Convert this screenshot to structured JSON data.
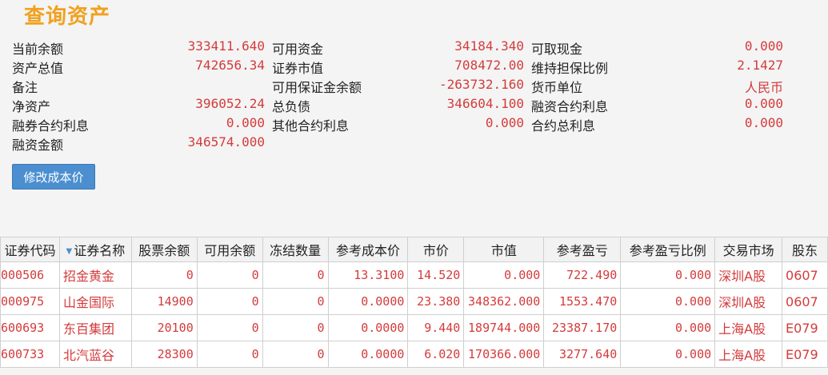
{
  "page": {
    "title": "查询资产"
  },
  "summary": {
    "rows": [
      [
        {
          "label": "当前余额",
          "value": "333411.640"
        },
        {
          "label": "可用资金",
          "value": "34184.340"
        },
        {
          "label": "可取现金",
          "value": "0.000"
        }
      ],
      [
        {
          "label": "资产总值",
          "value": "742656.34"
        },
        {
          "label": "证券市值",
          "value": "708472.00"
        },
        {
          "label": "维持担保比例",
          "value": "2.1427"
        }
      ],
      [
        {
          "label": "备注",
          "value": ""
        },
        {
          "label": "可用保证金余额",
          "value": "-263732.160"
        },
        {
          "label": "货币单位",
          "value": "人民币"
        }
      ],
      [
        {
          "label": "净资产",
          "value": "396052.24"
        },
        {
          "label": "总负债",
          "value": "346604.100"
        },
        {
          "label": "融资合约利息",
          "value": "0.000"
        }
      ],
      [
        {
          "label": "融券合约利息",
          "value": "0.000"
        },
        {
          "label": "其他合约利息",
          "value": "0.000"
        },
        {
          "label": "合约总利息",
          "value": "0.000"
        }
      ],
      [
        {
          "label": "融资金额",
          "value": "346574.000"
        }
      ]
    ]
  },
  "actions": {
    "modify_cost_label": "修改成本价"
  },
  "holdings": {
    "columns": [
      "证券代码",
      "证券名称",
      "股票余额",
      "可用余额",
      "冻结数量",
      "参考成本价",
      "市价",
      "市值",
      "参考盈亏",
      "参考盈亏比例",
      "交易市场",
      "股东"
    ],
    "sort_icon": "sort-down-icon",
    "rows": [
      [
        "000506",
        "招金黄金",
        "0",
        "0",
        "0",
        "13.3100",
        "14.520",
        "0.000",
        "722.490",
        "0.000",
        "深圳A股",
        "0607"
      ],
      [
        "000975",
        "山金国际",
        "14900",
        "0",
        "0",
        "0.0000",
        "23.380",
        "348362.000",
        "1553.470",
        "0.000",
        "深圳A股",
        "0607"
      ],
      [
        "600693",
        "东百集团",
        "20100",
        "0",
        "0",
        "0.0000",
        "9.440",
        "189744.000",
        "23387.170",
        "0.000",
        "上海A股",
        "E079"
      ],
      [
        "600733",
        "北汽蓝谷",
        "28300",
        "0",
        "0",
        "0.0000",
        "6.020",
        "170366.000",
        "3277.640",
        "0.000",
        "上海A股",
        "E079"
      ]
    ]
  },
  "colors": {
    "accent": "#f0a11f",
    "value_red": "#d43b3b",
    "button_blue": "#4b8fd0"
  }
}
